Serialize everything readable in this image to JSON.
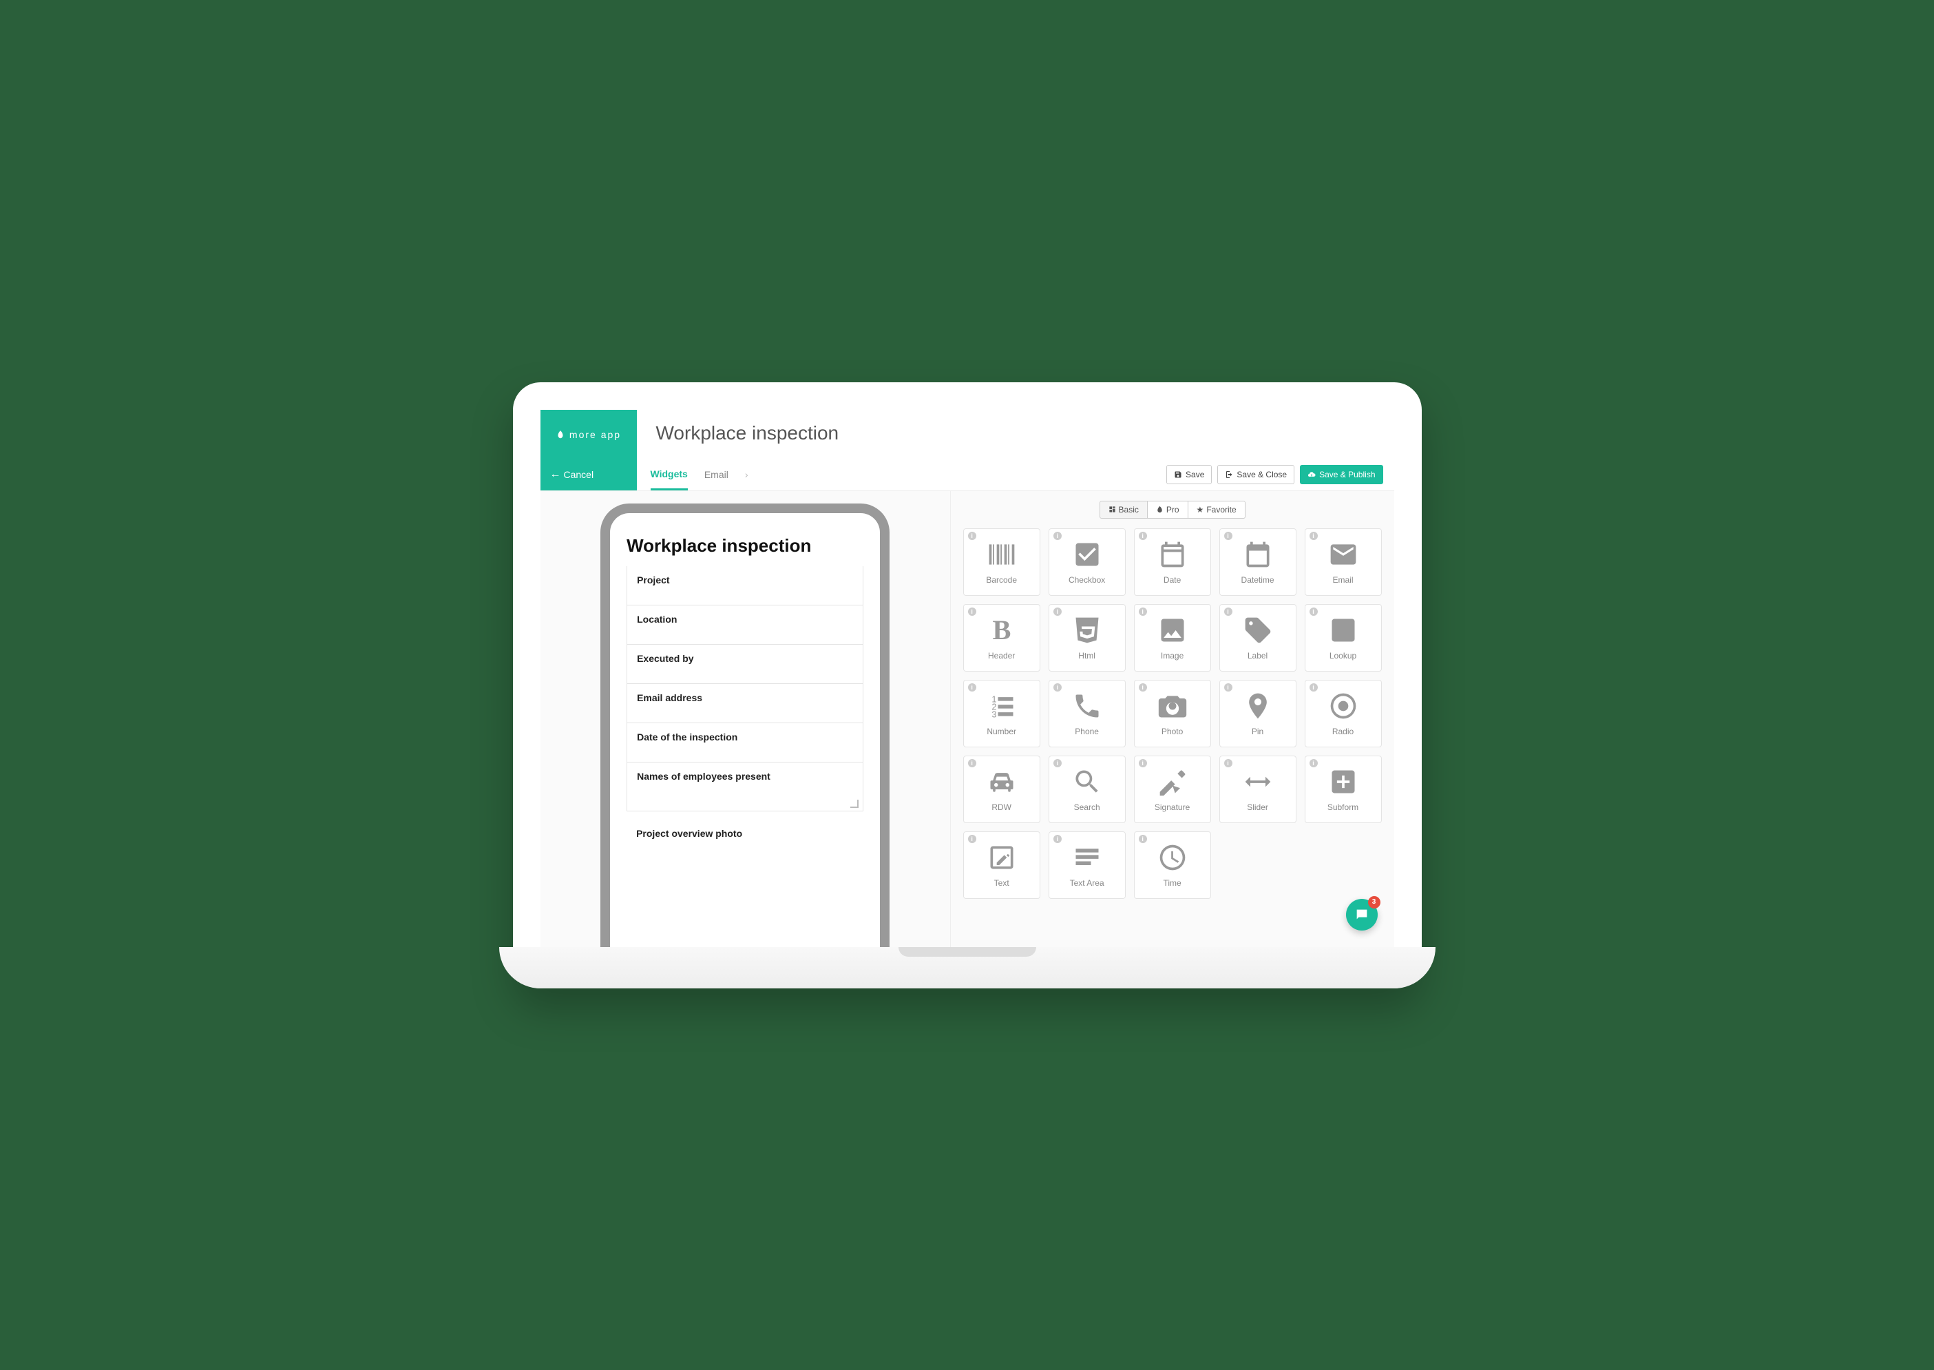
{
  "brand": "more app",
  "page_title": "Workplace inspection",
  "cancel_label": "Cancel",
  "tabs": {
    "widgets": "Widgets",
    "email": "Email"
  },
  "buttons": {
    "save": "Save",
    "save_close": "Save & Close",
    "save_publish": "Save & Publish"
  },
  "form": {
    "title": "Workplace inspection",
    "fields": [
      "Project",
      "Location",
      "Executed by",
      "Email address",
      "Date of the inspection",
      "Names of employees present",
      "Project overview photo"
    ]
  },
  "filters": {
    "basic": "Basic",
    "pro": "Pro",
    "favorite": "Favorite"
  },
  "widgets": [
    "Barcode",
    "Checkbox",
    "Date",
    "Datetime",
    "Email",
    "Header",
    "Html",
    "Image",
    "Label",
    "Lookup",
    "Number",
    "Phone",
    "Photo",
    "Pin",
    "Radio",
    "RDW",
    "Search",
    "Signature",
    "Slider",
    "Subform",
    "Text",
    "Text Area",
    "Time"
  ],
  "chat_badge": "3"
}
